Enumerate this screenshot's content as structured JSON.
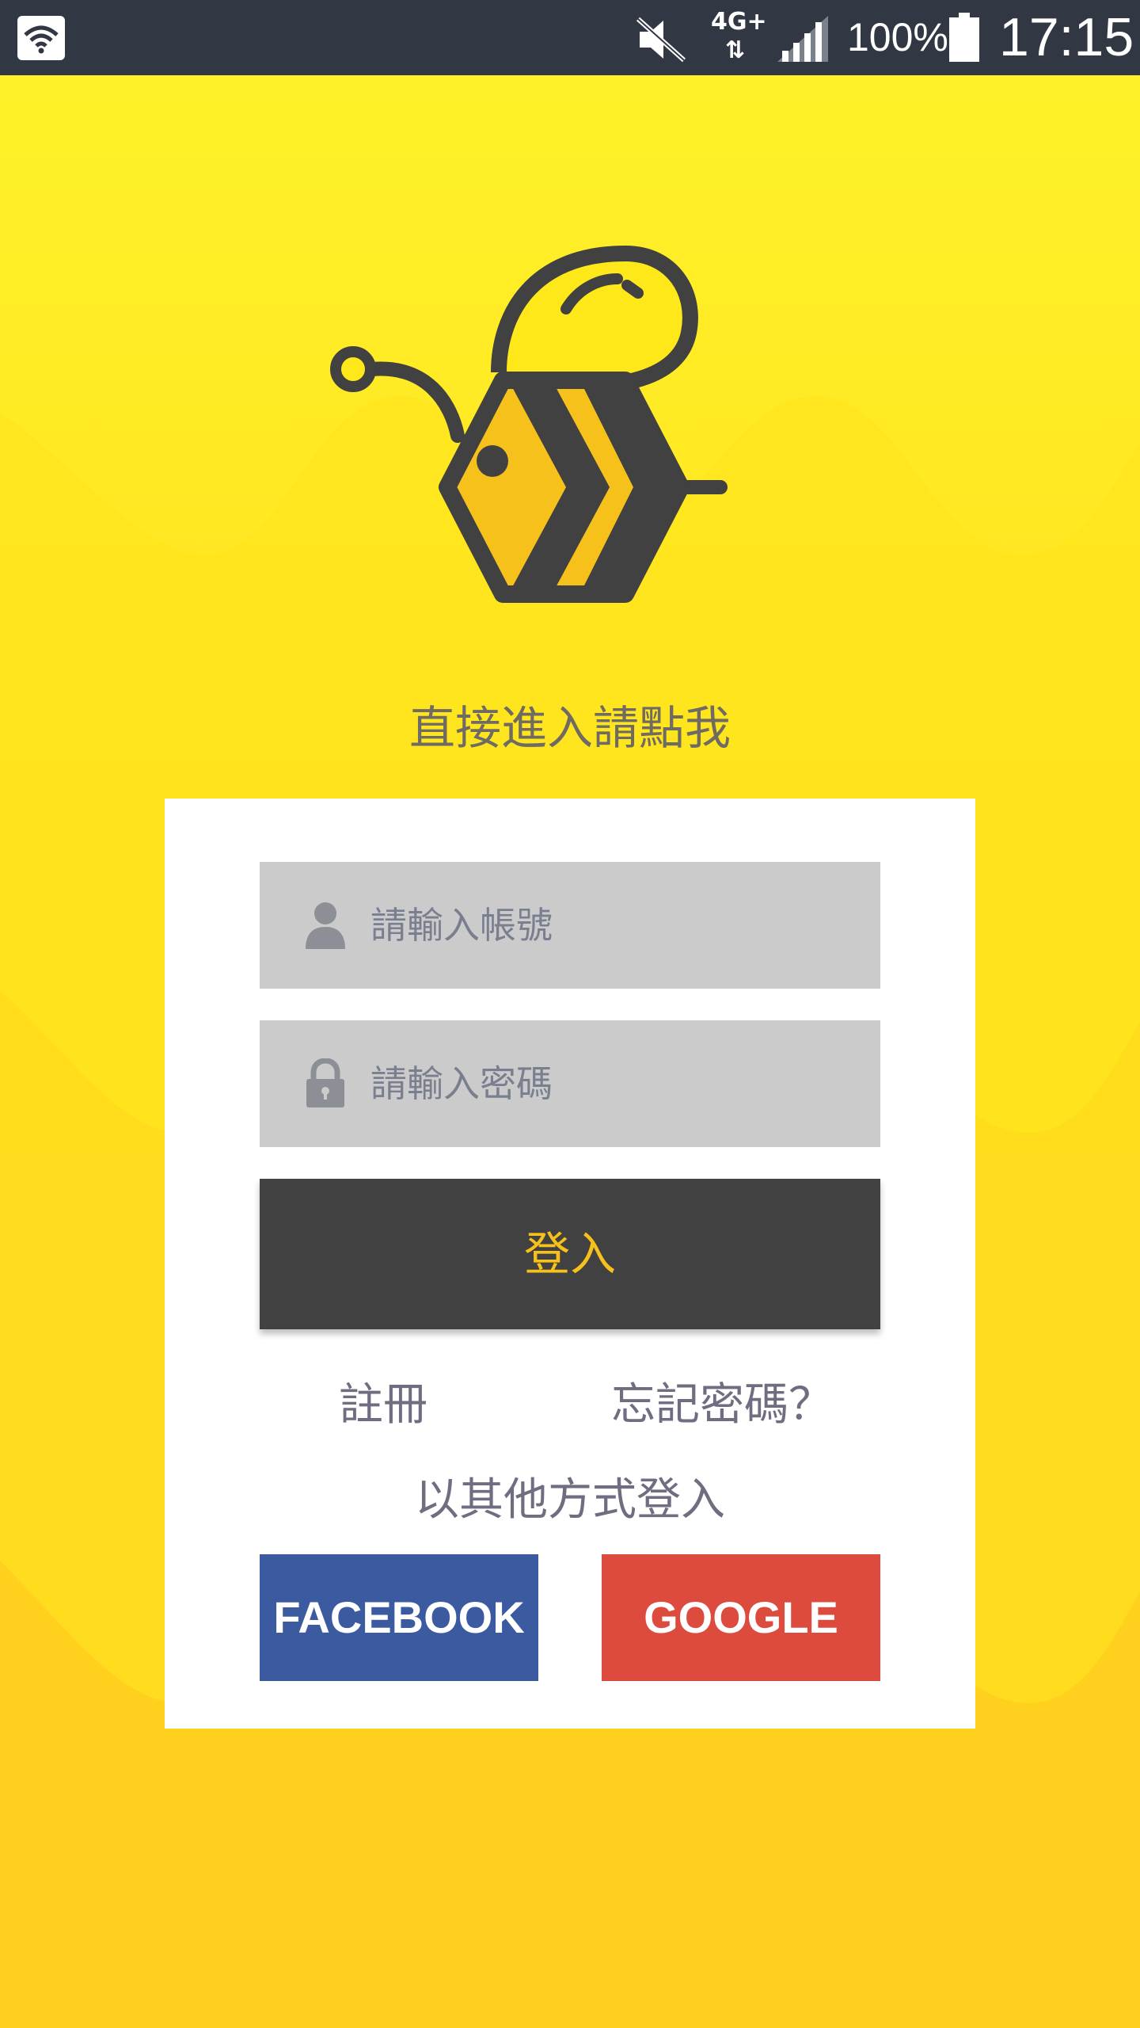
{
  "status_bar": {
    "network": "4G+",
    "network_arrows": "⇅",
    "battery": "100%",
    "time": "17:15",
    "icons": [
      "wifi-icon",
      "mute-icon",
      "signal-icon",
      "battery-icon"
    ]
  },
  "logo": {
    "icon": "bee-logo"
  },
  "guest_link": "直接進入請點我",
  "login_card": {
    "username_placeholder": "請輸入帳號",
    "password_placeholder": "請輸入密碼",
    "login_button": "登入",
    "register_link": "註冊",
    "forgot_link": "忘記密碼？",
    "other_methods": "以其他方式登入",
    "facebook_button": "FACEBOOK",
    "google_button": "GOOGLE"
  },
  "colors": {
    "background_top": "#fff22a",
    "background_bottom": "#ffc81e",
    "status_bar": "#313843",
    "login_button_bg": "#414141",
    "login_button_text": "#f7c11c",
    "facebook": "#3b5aa0",
    "google": "#dd4b3e",
    "field_bg": "#cbcbcb"
  }
}
